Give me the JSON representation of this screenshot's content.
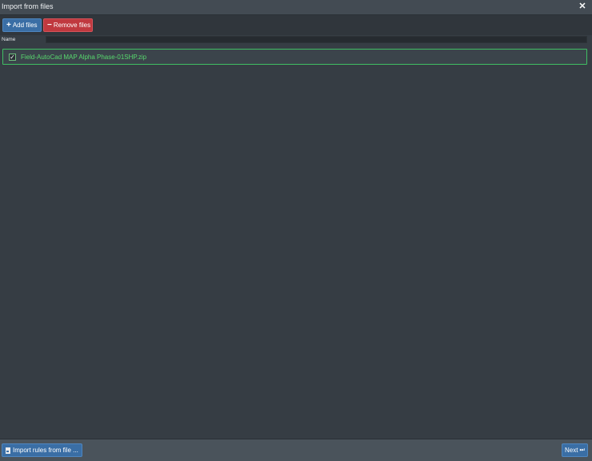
{
  "window": {
    "title": "Import from files",
    "close_glyph": "✕"
  },
  "toolbar": {
    "add_glyph": "+",
    "add_label": "Add files",
    "remove_glyph": "−",
    "remove_label": "Remove files"
  },
  "table": {
    "name_header": "Name",
    "filter_value": ""
  },
  "files": [
    {
      "checked": true,
      "check_glyph": "✓",
      "name": "Field-AutoCad MAP Alpha Phase-01SHP.zip"
    }
  ],
  "footer": {
    "import_label": "Import rules from file ...",
    "next_label": "Next",
    "next_glyph": "⏭"
  },
  "colors": {
    "primary_button": "#3a6ea5",
    "danger_button": "#c0393f",
    "selected_border": "#3fbf63",
    "selected_text": "#58d86e"
  }
}
